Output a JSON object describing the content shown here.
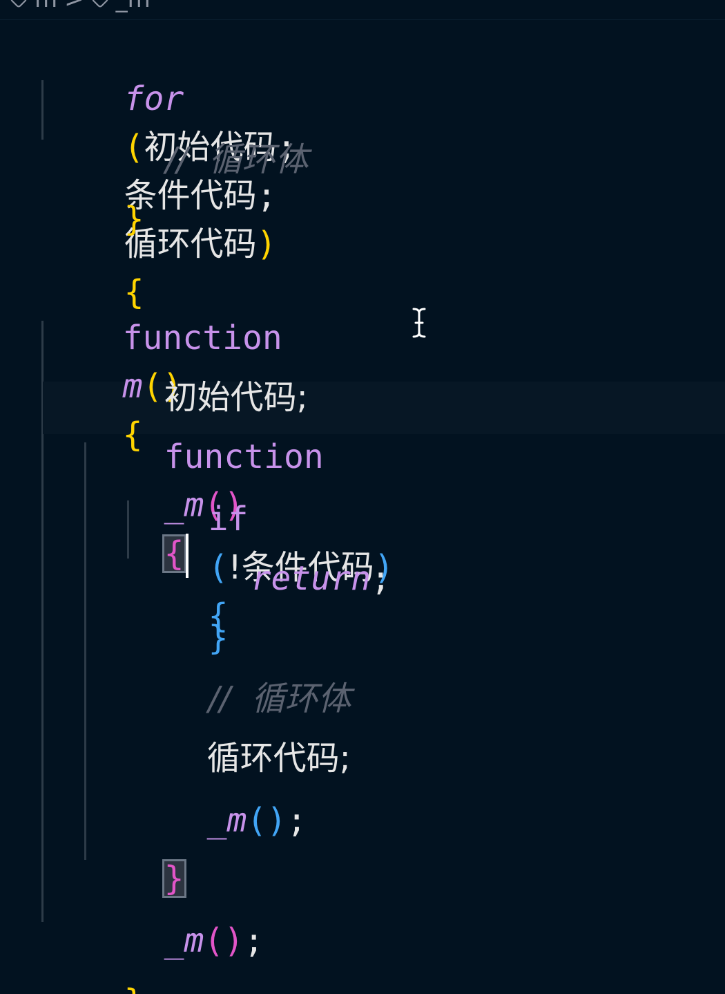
{
  "breadcrumb": {
    "items": [
      {
        "icon": "cube-icon",
        "label": "m"
      },
      {
        "icon": "cube-icon",
        "label": "_m"
      }
    ],
    "separator": ">"
  },
  "code": {
    "for_loop": {
      "keyword": "for",
      "open_paren": "(",
      "init": "初始代码",
      "semi_1": ";",
      "condition": "条件代码",
      "semi_2": ";",
      "step": "循环代码",
      "close_paren": ")",
      "open_brace": "{",
      "body_comment": "//  循环体",
      "close_brace": "}"
    },
    "function_m": {
      "keyword": "function",
      "name": "m",
      "parens": "()",
      "open_brace": "{",
      "init_stmt": "初始代码;",
      "close_brace": "}"
    },
    "function_inner": {
      "keyword": "function",
      "name": "_m",
      "parens": "()",
      "open_brace": "{",
      "close_brace": "}"
    },
    "if_block": {
      "keyword": "if",
      "open_paren": "(",
      "condition": "!条件代码",
      "close_paren": ")",
      "open_brace": "{",
      "return_keyword": "return",
      "semicolon": ";",
      "close_brace": "}"
    },
    "body_comment_2": "//  循环体",
    "step_stmt": "循环代码;",
    "inner_call": {
      "name": "_m",
      "open_paren": "(",
      "close_paren": ")",
      "semicolon": ";"
    },
    "outer_call": {
      "name": "_m",
      "open_paren": "(",
      "close_paren": ")",
      "semicolon": ";"
    }
  },
  "colors": {
    "background": "#021220",
    "keyword": "#c792ea",
    "yellow_bracket": "#ffd400",
    "blue_bracket": "#42a5f5",
    "magenta_bracket": "#e255c8",
    "comment": "#5b6270"
  }
}
